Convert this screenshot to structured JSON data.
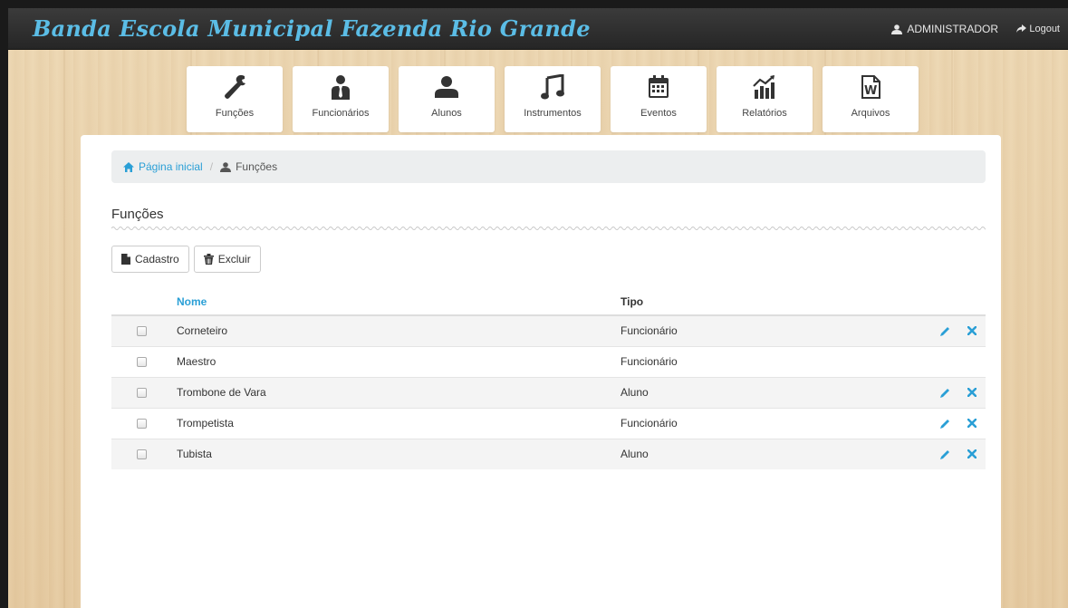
{
  "app": {
    "brand": "Banda Escola Municipal Fazenda Rio Grande",
    "user": "ADMINISTRADOR",
    "logout": "Logout"
  },
  "nav": [
    {
      "label": "Funções",
      "icon": "wrench-icon"
    },
    {
      "label": "Funcionários",
      "icon": "employee-icon"
    },
    {
      "label": "Alunos",
      "icon": "user-icon"
    },
    {
      "label": "Instrumentos",
      "icon": "music-note-icon"
    },
    {
      "label": "Eventos",
      "icon": "calendar-icon"
    },
    {
      "label": "Relatórios",
      "icon": "stats-icon"
    },
    {
      "label": "Arquivos",
      "icon": "word-file-icon"
    }
  ],
  "breadcrumb": {
    "home": "Página inicial",
    "current": "Funções"
  },
  "page": {
    "title": "Funções",
    "btn_new": "Cadastro",
    "btn_delete": "Excluir"
  },
  "table": {
    "headers": {
      "nome": "Nome",
      "tipo": "Tipo"
    },
    "rows": [
      {
        "nome": "Corneteiro",
        "tipo": "Funcionário",
        "actions": true
      },
      {
        "nome": "Maestro",
        "tipo": "Funcionário",
        "actions": false
      },
      {
        "nome": "Trombone de Vara",
        "tipo": "Aluno",
        "actions": true
      },
      {
        "nome": "Trompetista",
        "tipo": "Funcionário",
        "actions": true
      },
      {
        "nome": "Tubista",
        "tipo": "Aluno",
        "actions": true
      }
    ]
  },
  "colors": {
    "accent": "#2a9fd6",
    "brand": "#5bbde6",
    "topbar": "#2f2f2f"
  }
}
